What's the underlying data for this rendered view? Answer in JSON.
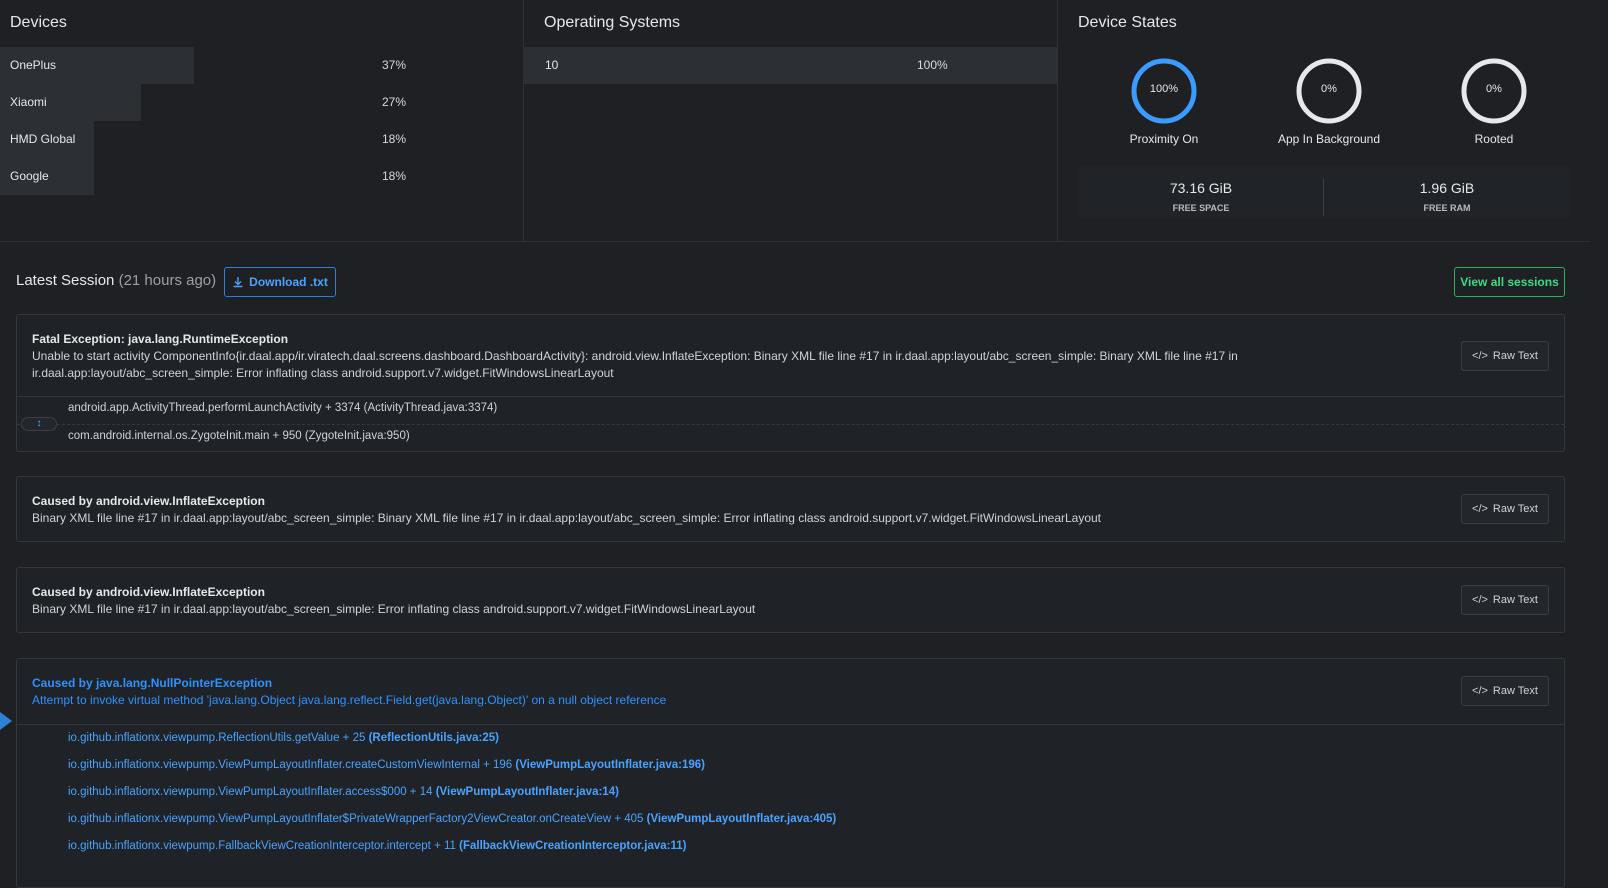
{
  "devices": {
    "title": "Devices",
    "rows": [
      {
        "name": "OnePlus",
        "pct": "37%",
        "value": 37
      },
      {
        "name": "Xiaomi",
        "pct": "27%",
        "value": 27
      },
      {
        "name": "HMD Global",
        "pct": "18%",
        "value": 18
      },
      {
        "name": "Google",
        "pct": "18%",
        "value": 18
      }
    ]
  },
  "os": {
    "title": "Operating Systems",
    "rows": [
      {
        "name": "10",
        "pct": "100%",
        "value": 100
      }
    ]
  },
  "states": {
    "title": "Device States",
    "gauges": [
      {
        "value_text": "100%",
        "value": 100,
        "label": "Proximity On",
        "color": "#3b9cff"
      },
      {
        "value_text": "0%",
        "value": 0,
        "label": "App In Background",
        "color": "#e6e8eb"
      },
      {
        "value_text": "0%",
        "value": 0,
        "label": "Rooted",
        "color": "#e6e8eb"
      }
    ],
    "free_space": {
      "value": "73.16 GiB",
      "label": "FREE SPACE"
    },
    "free_ram": {
      "value": "1.96 GiB",
      "label": "FREE RAM"
    }
  },
  "session": {
    "title": "Latest Session",
    "ago": "(21 hours ago)",
    "download_label": "Download .txt",
    "view_all_label": "View all sessions"
  },
  "raw_text_label": "Raw Text",
  "exceptions": [
    {
      "title": "Fatal Exception: java.lang.RuntimeException",
      "desc": "Unable to start activity ComponentInfo{ir.daal.app/ir.viratech.daal.screens.dashboard.DashboardActivity}: android.view.InflateException: Binary XML file line #17 in ir.daal.app:layout/abc_screen_simple: Binary XML file line #17 in ir.daal.app:layout/abc_screen_simple: Error inflating class android.support.v7.widget.FitWindowsLinearLayout",
      "frames": [
        "android.app.ActivityThread.performLaunchActivity + 3374 (ActivityThread.java:3374)",
        "com.android.internal.os.ZygoteInit.main + 950 (ZygoteInit.java:950)"
      ]
    },
    {
      "title": "Caused by android.view.InflateException",
      "desc": "Binary XML file line #17 in ir.daal.app:layout/abc_screen_simple: Binary XML file line #17 in ir.daal.app:layout/abc_screen_simple: Error inflating class android.support.v7.widget.FitWindowsLinearLayout"
    },
    {
      "title": "Caused by android.view.InflateException",
      "desc": "Binary XML file line #17 in ir.daal.app:layout/abc_screen_simple: Error inflating class android.support.v7.widget.FitWindowsLinearLayout"
    },
    {
      "title": "Caused by java.lang.NullPointerException",
      "desc": "Attempt to invoke virtual method 'java.lang.Object java.lang.reflect.Field.get(java.lang.Object)' on a null object reference",
      "frames": [
        {
          "method": "io.github.inflationx.viewpump.ReflectionUtils.getValue + 25",
          "file": "(ReflectionUtils.java:25)"
        },
        {
          "method": "io.github.inflationx.viewpump.ViewPumpLayoutInflater.createCustomViewInternal + 196",
          "file": "(ViewPumpLayoutInflater.java:196)"
        },
        {
          "method": "io.github.inflationx.viewpump.ViewPumpLayoutInflater.access$000 + 14",
          "file": "(ViewPumpLayoutInflater.java:14)"
        },
        {
          "method": "io.github.inflationx.viewpump.ViewPumpLayoutInflater$PrivateWrapperFactory2ViewCreator.onCreateView + 405",
          "file": "(ViewPumpLayoutInflater.java:405)"
        },
        {
          "method": "io.github.inflationx.viewpump.FallbackViewCreationInterceptor.intercept + 11",
          "file": "(FallbackViewCreationInterceptor.java:11)"
        }
      ]
    }
  ]
}
